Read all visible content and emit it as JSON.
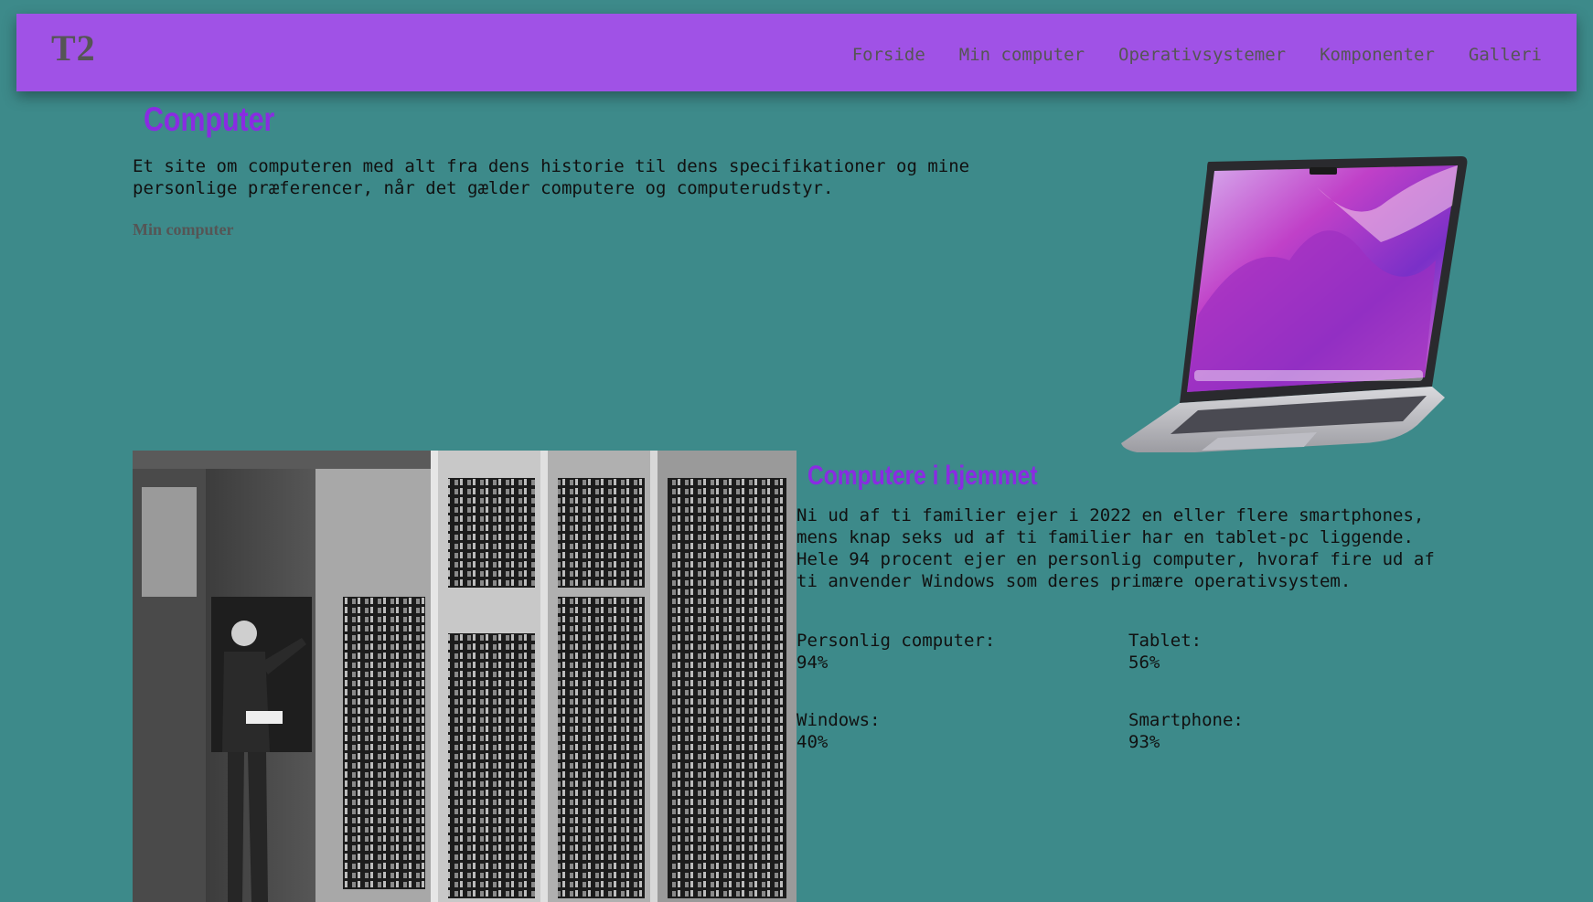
{
  "nav": {
    "logo": "T2",
    "links": [
      "Forside",
      "Min computer",
      "Operativsystemer",
      "Komponenter",
      "Galleri"
    ]
  },
  "intro": {
    "title": "Computer",
    "text": "Et site om computeren med alt fra dens historie til dens specifikationer og mine personlige præferencer, når det gælder computere og computerudstyr.",
    "link": "Min computer"
  },
  "home": {
    "title": "Computere i hjemmet",
    "text": "Ni ud af ti familier ejer i 2022 en eller flere smartphones, mens knap seks ud af ti familier har en tablet-pc liggende. Hele 94 procent ejer en personlig computer, hvoraf fire ud af ti anvender Windows som deres primære operativsystem.",
    "stats": [
      {
        "label": "Personlig computer:",
        "value": "94%"
      },
      {
        "label": "Tablet:",
        "value": "56%"
      },
      {
        "label": "Windows:",
        "value": "40%"
      },
      {
        "label": "Smartphone:",
        "value": "93%"
      }
    ]
  },
  "colors": {
    "background": "#3d8a8a",
    "navbar": "#a052e6",
    "heading": "#8a2be2",
    "muted_text": "#555555"
  },
  "icons": {
    "laptop_image": "laptop-image",
    "photo": "vintage-computer-photo"
  }
}
